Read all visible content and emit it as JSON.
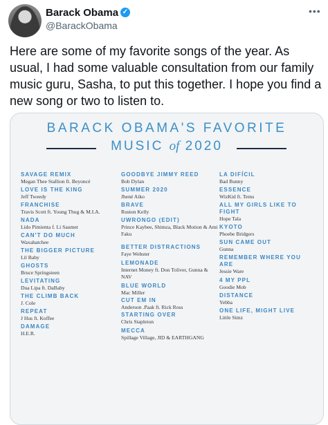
{
  "author": {
    "name": "Barack Obama",
    "handle": "@BarackObama",
    "verified_icon": "check-badge",
    "more_icon": "ellipsis"
  },
  "tweet": {
    "text": "Here are some of my favorite songs of the year. As usual, I had some valuable consultation from our family music guru, Sasha, to put this together. I hope you find a new song or two to listen to."
  },
  "card": {
    "title_line1": "BARACK OBAMA'S FAVORITE",
    "title_music": "MUSIC",
    "title_of": "of",
    "title_year": "2020",
    "colors": {
      "title": "#3b8fc9",
      "rule": "#1f2a44",
      "background": "#f2f4f5"
    },
    "columns": [
      [
        {
          "title": "SAVAGE REMIX",
          "artist": "Megan Thee Stallion ft. Beyoncé"
        },
        {
          "title": "LOVE IS THE KING",
          "artist": "Jeff Tweedy"
        },
        {
          "title": "FRANCHISE",
          "artist": "Travis Scott ft. Young Thug & M.I.A."
        },
        {
          "title": "NADA",
          "artist": "Lido Pimienta f. Li Saumet"
        },
        {
          "title": "CAN'T DO MUCH",
          "artist": "Waxahatchee"
        },
        {
          "title": "THE BIGGER PICTURE",
          "artist": "Lil Baby"
        },
        {
          "title": "GHOSTS",
          "artist": "Bruce Springsteen"
        },
        {
          "title": "LEVITATING",
          "artist": "Dua Lipa ft. DaBaby"
        },
        {
          "title": "THE CLIMB BACK",
          "artist": "J. Cole"
        },
        {
          "title": "REPEAT",
          "artist": "J Hus ft. Koffee"
        },
        {
          "title": "DAMAGE",
          "artist": "H.E.R."
        }
      ],
      [
        {
          "title": "GOODBYE JIMMY REED",
          "artist": "Bob Dylan"
        },
        {
          "title": "SUMMER 2020",
          "artist": "Jhené Aiko"
        },
        {
          "title": "BRAVE",
          "artist": "Ruston Kelly"
        },
        {
          "title": "UWRONGO (EDIT)",
          "artist": "Prince Kaybee, Shimza, Black Motion & Ami Faku"
        },
        {
          "title": "BETTER DISTRACTIONS",
          "artist": "Faye Webster"
        },
        {
          "title": "LEMONADE",
          "artist": "Internet Money ft. Don Toliver, Gunna & NAV"
        },
        {
          "title": "BLUE WORLD",
          "artist": "Mac Miller"
        },
        {
          "title": "CUT EM IN",
          "artist": "Anderson .Paak ft. Rick Ross"
        },
        {
          "title": "STARTING OVER",
          "artist": "Chris Stapleton"
        },
        {
          "title": "MECCA",
          "artist": "Spillage Village, JID & EARTHGANG"
        }
      ],
      [
        {
          "title": "LA DIFÍCIL",
          "artist": "Bad Bunny"
        },
        {
          "title": "ESSENCE",
          "artist": "WizKid ft. Tems"
        },
        {
          "title": "ALL MY GIRLS LIKE TO FIGHT",
          "artist": "Hope Tala"
        },
        {
          "title": "KYOTO",
          "artist": "Phoebe Bridgers"
        },
        {
          "title": "SUN CAME OUT",
          "artist": "Gunna"
        },
        {
          "title": "REMEMBER WHERE YOU ARE",
          "artist": "Jessie Ware"
        },
        {
          "title": "4 MY PPL",
          "artist": "Goodie Mob"
        },
        {
          "title": "DISTANCE",
          "artist": "Yebba"
        },
        {
          "title": "ONE LIFE, MIGHT LIVE",
          "artist": "Little Simz"
        }
      ]
    ]
  }
}
